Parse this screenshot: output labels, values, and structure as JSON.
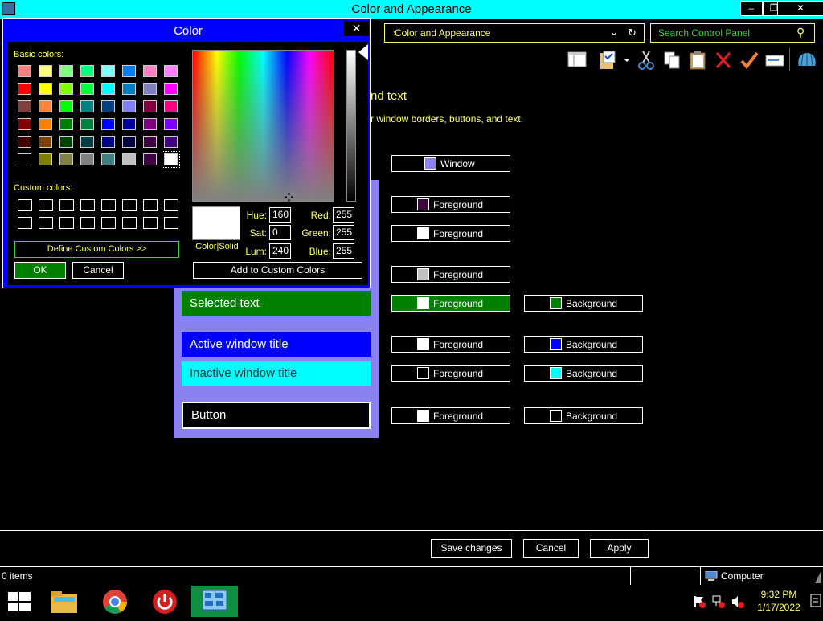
{
  "window": {
    "title": "Color and Appearance",
    "minimize": "‒",
    "restore": "❐",
    "close": "✕"
  },
  "address": {
    "path": "Color and Appearance",
    "separator": "›",
    "dropdown": "⌄",
    "refresh": "↻"
  },
  "search": {
    "placeholder": "Search Control Panel",
    "icon": "⚲"
  },
  "main": {
    "heading_fragment": "nd text",
    "description_fragment": "r window borders, buttons, and text."
  },
  "preview": {
    "selected_text": "Selected text",
    "active_title": "Active window title",
    "inactive_title": "Inactive window title",
    "button": "Button"
  },
  "rows": [
    {
      "left_label": "Window",
      "left_color": "#8a82f0"
    },
    {
      "left_label": "Foreground",
      "left_color": "#3a0a3a"
    },
    {
      "left_label": "Foreground",
      "left_color": "#ffffff"
    },
    {
      "left_label": "Foreground",
      "left_color": "#c0c0c0"
    },
    {
      "left_label": "Foreground",
      "left_color": "#ffffff",
      "right_label": "Background",
      "right_color": "#008000"
    },
    {
      "left_label": "Foreground",
      "left_color": "#ffffff",
      "right_label": "Background",
      "right_color": "#0000ff"
    },
    {
      "left_label": "Foreground",
      "left_color": "#000000",
      "right_label": "Background",
      "right_color": "#00ffff"
    },
    {
      "left_label": "Foreground",
      "left_color": "#ffffff",
      "right_label": "Background",
      "right_color": "#000000"
    }
  ],
  "footer": {
    "save": "Save changes",
    "cancel": "Cancel",
    "apply": "Apply"
  },
  "statusbar": {
    "items": "0 items",
    "location": "Computer"
  },
  "taskbar": {
    "time": "9:32 PM",
    "date": "1/17/2022"
  },
  "dialog": {
    "title": "Color",
    "close": "✕",
    "basic_label": "Basic colors:",
    "custom_label": "Custom colors:",
    "define_custom": "Define Custom Colors >>",
    "ok": "OK",
    "cancel": "Cancel",
    "add_custom": "Add to Custom Colors",
    "color_solid": "Color|Solid",
    "hue_label": "Hue:",
    "hue": "160",
    "sat_label": "Sat:",
    "sat": "0",
    "lum_label": "Lum:",
    "lum": "240",
    "red_label": "Red:",
    "red": "255",
    "green_label": "Green:",
    "green": "255",
    "blue_label": "Blue:",
    "blue": "255",
    "selected_color": "#ffffff",
    "basic_colors": [
      [
        "#ff8080",
        "#ffff80",
        "#80ff80",
        "#00ff80",
        "#80ffff",
        "#0080ff",
        "#ff80c0",
        "#ff80ff"
      ],
      [
        "#ff0000",
        "#ffff00",
        "#80ff00",
        "#00ff40",
        "#00ffff",
        "#0080c0",
        "#8080c0",
        "#ff00ff"
      ],
      [
        "#804040",
        "#ff8040",
        "#00ff00",
        "#008080",
        "#004080",
        "#8080ff",
        "#800040",
        "#ff0080"
      ],
      [
        "#800000",
        "#ff8000",
        "#008000",
        "#008040",
        "#0000ff",
        "#0000a0",
        "#800080",
        "#8000ff"
      ],
      [
        "#400000",
        "#804000",
        "#004000",
        "#004040",
        "#000080",
        "#000040",
        "#400040",
        "#400080"
      ],
      [
        "#000000",
        "#808000",
        "#808040",
        "#808080",
        "#408080",
        "#c0c0c0",
        "#400040",
        "#ffffff"
      ]
    ]
  }
}
